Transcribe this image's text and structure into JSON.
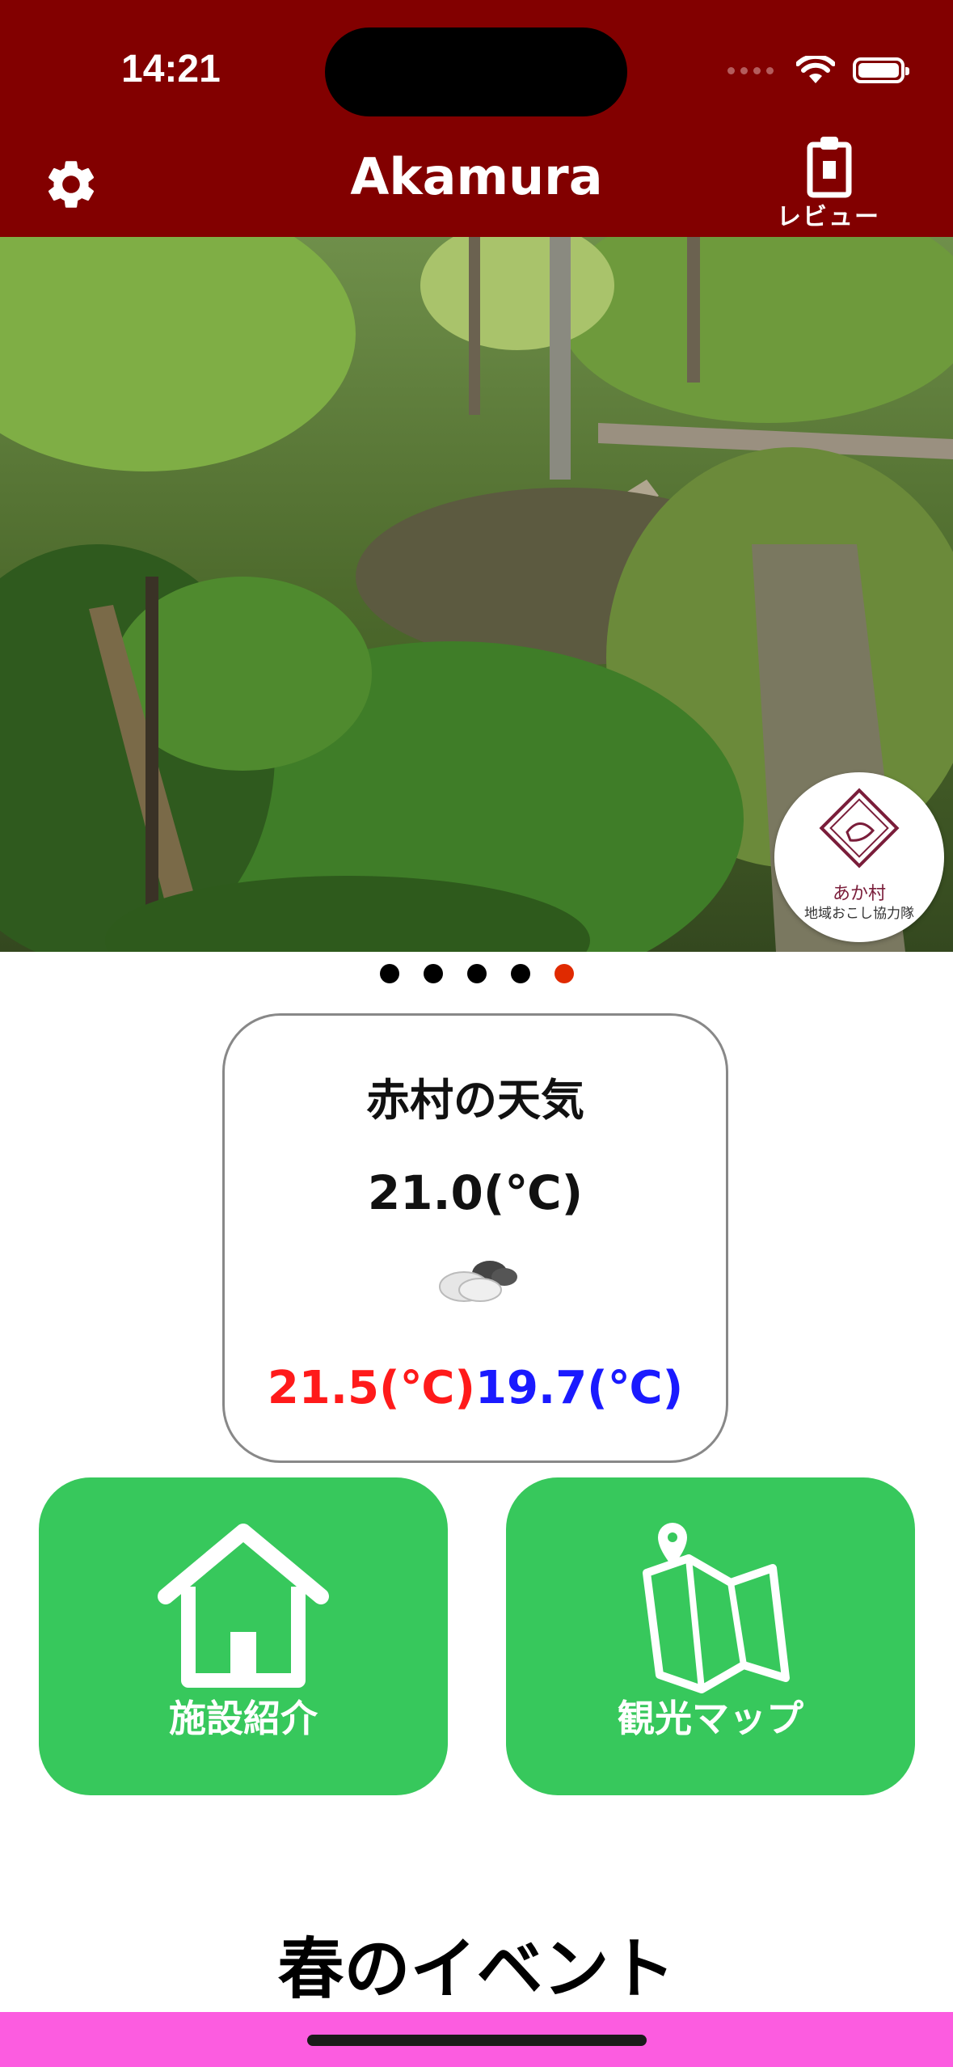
{
  "status_bar": {
    "time": "14:21"
  },
  "header": {
    "title": "Akamura",
    "review_label": "レビュー"
  },
  "hero": {
    "badge_line1": "あか村",
    "badge_line2": "地域おこし協力隊",
    "pager_count": 5,
    "pager_active_index": 4
  },
  "weather": {
    "title": "赤村の天気",
    "current": "21.0(℃)",
    "icon": "cloud-icon",
    "high": "21.5(℃)",
    "low": "19.7(℃)",
    "high_color": "#ff1a1a",
    "low_color": "#1a1aff"
  },
  "tiles": [
    {
      "label": "施設紹介",
      "icon": "house-icon"
    },
    {
      "label": "観光マップ",
      "icon": "map-icon"
    }
  ],
  "section": {
    "title": "春のイベント"
  },
  "colors": {
    "header_bg": "#820000",
    "tile_bg": "#37c85c",
    "accent_dot": "#e02a00",
    "bottom_bar": "#fc5ce0"
  }
}
